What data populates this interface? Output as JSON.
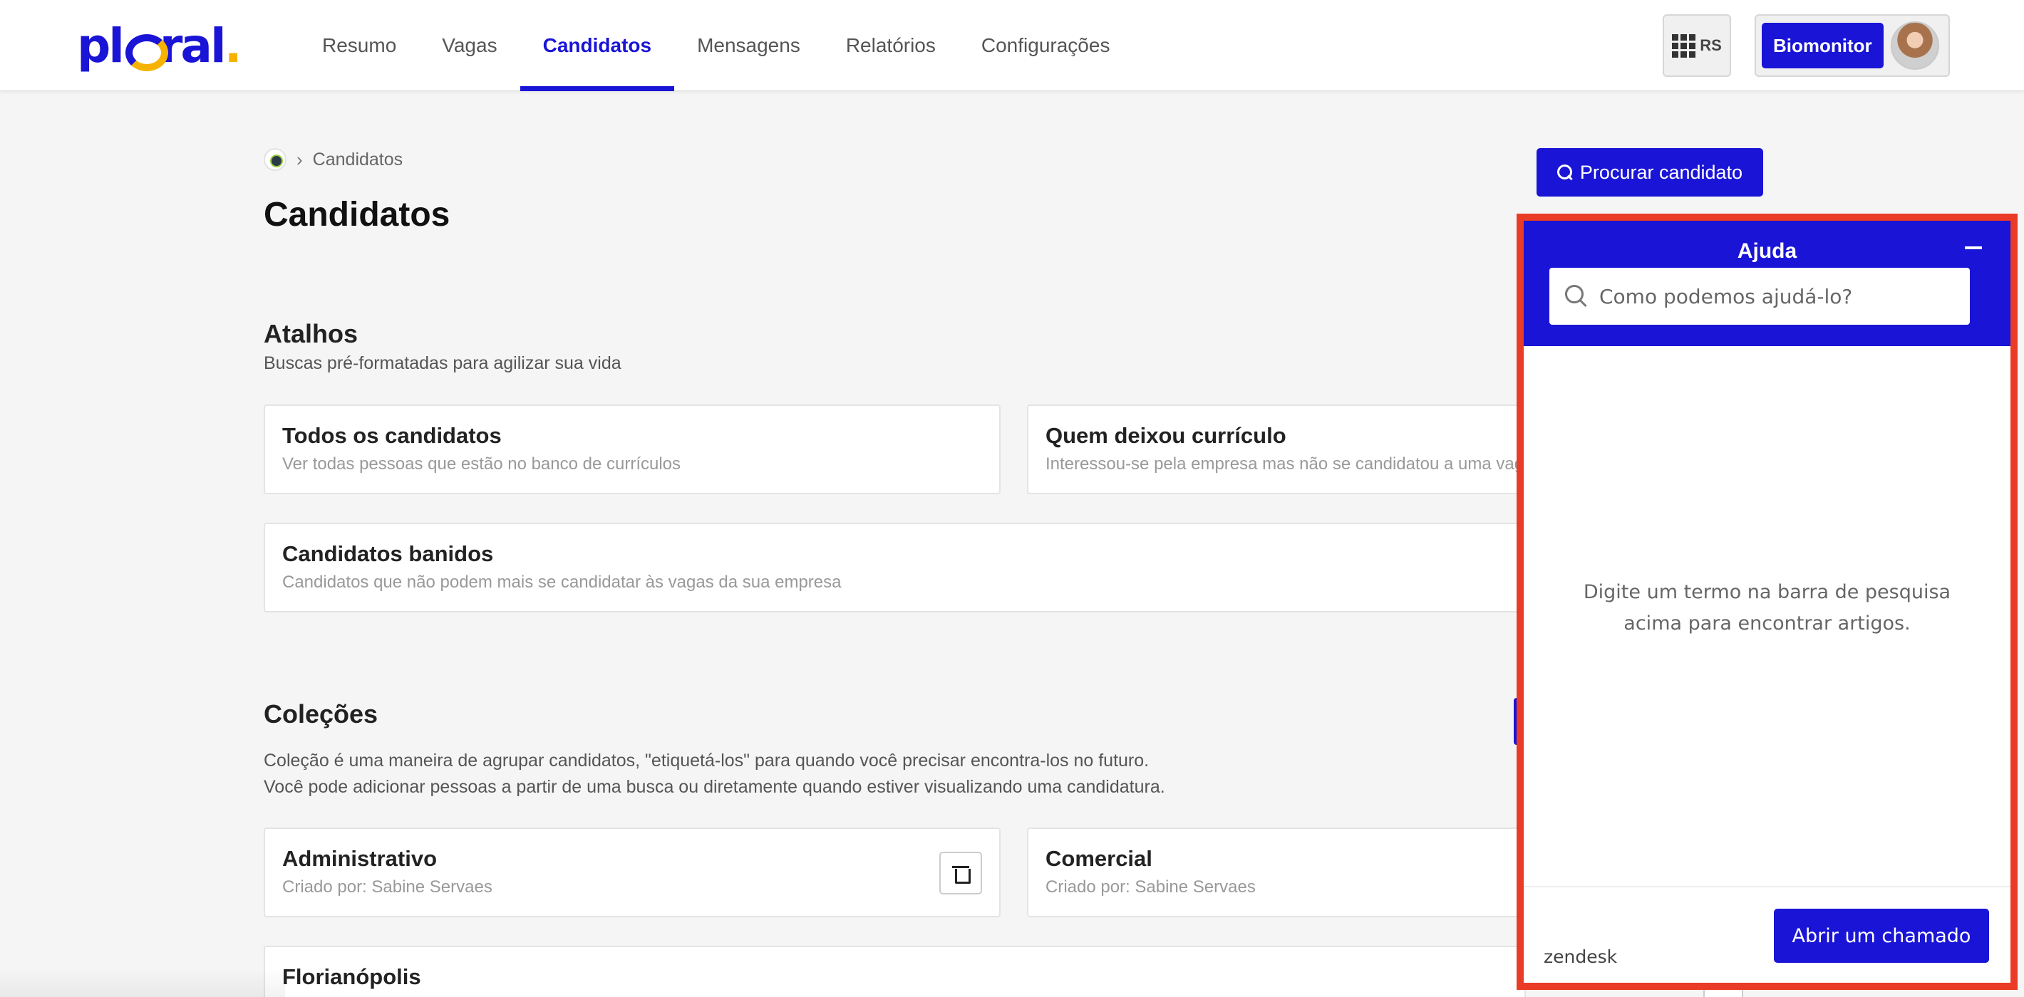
{
  "brand": {
    "logo_left": "pl",
    "logo_right": "ral",
    "logo_dot": ".",
    "accent": "#1a14d6",
    "highlight": "#ea3b26"
  },
  "nav": {
    "items": [
      {
        "label": "Resumo"
      },
      {
        "label": "Vagas"
      },
      {
        "label": "Candidatos"
      },
      {
        "label": "Mensagens"
      },
      {
        "label": "Relatórios"
      },
      {
        "label": "Configurações"
      }
    ],
    "active": "Candidatos"
  },
  "header": {
    "apps_initials": "RS",
    "company_button": "Biomonitor"
  },
  "breadcrumb": {
    "current": "Candidatos"
  },
  "page": {
    "title": "Candidatos",
    "search_button": "Procurar candidato"
  },
  "shortcuts": {
    "title": "Atalhos",
    "subtitle": "Buscas pré-formatadas para agilizar sua vida",
    "cards": [
      {
        "title": "Todos os candidatos",
        "desc": "Ver todas pessoas que estão no banco de currículos"
      },
      {
        "title": "Quem deixou currículo",
        "desc": "Interessou-se pela empresa mas não se candidatou a uma vaga específica"
      },
      {
        "title": "Candidatos banidos",
        "desc": "Candidatos que não podem mais se candidatar às vagas da sua empresa"
      }
    ]
  },
  "collections": {
    "title": "Coleções",
    "line1": "Coleção é uma maneira de agrupar candidatos, \"etiquetá-los\" para quando você precisar encontra-los no futuro.",
    "line2": "Você pode adicionar pessoas a partir de uma busca ou diretamente quando estiver visualizando uma candidatura.",
    "cards": [
      {
        "title": "Administrativo",
        "desc": "Criado por: Sabine Servaes"
      },
      {
        "title": "Comercial",
        "desc": "Criado por: Sabine Servaes"
      },
      {
        "title": "Florianópolis",
        "desc": ""
      }
    ]
  },
  "help_widget": {
    "title": "Ajuda",
    "search_placeholder": "Como podemos ajudá-lo?",
    "empty_message": "Digite um termo na barra de pesquisa acima para encontrar artigos.",
    "footer_brand": "zendesk",
    "open_ticket": "Abrir um chamado"
  }
}
